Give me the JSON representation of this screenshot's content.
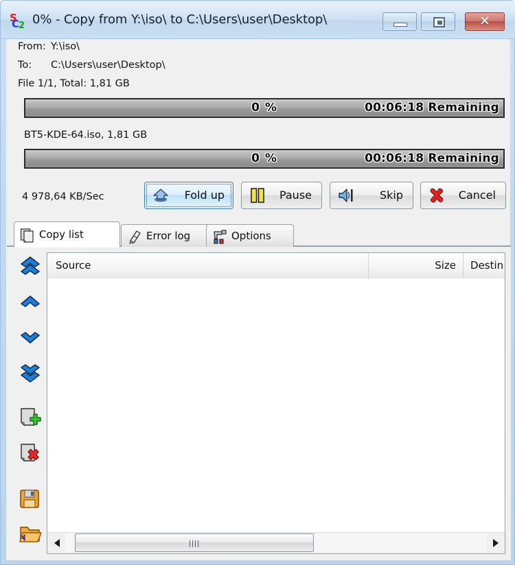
{
  "window": {
    "title": "0% - Copy from Y:\\iso\\ to C:\\Users\\user\\Desktop\\",
    "app_icon": "supercopier-sc2-icon",
    "controls": {
      "minimize_label": "Minimize",
      "maximize_label": "Maximize",
      "close_label": "Close",
      "close_glyph": "✕"
    },
    "accent_border": "#bcd4ec",
    "close_button_color": "#b94f45"
  },
  "transfer": {
    "from_label": "From:",
    "from_path": "Y:\\iso\\",
    "to_label": "To:",
    "to_path": "C:\\Users\\user\\Desktop\\",
    "file_summary": "File 1/1, Total: 1,81 GB",
    "speed": "4 978,64 KB/Sec",
    "current_file": "BT5-KDE-64.iso, 1,81 GB",
    "total_progress": {
      "percent_text": "0 %",
      "percent_value": 0,
      "remaining_text": "00:06:18 Remaining"
    },
    "file_progress": {
      "percent_text": "0 %",
      "percent_value": 0,
      "remaining_text": "00:06:18 Remaining"
    }
  },
  "buttons": [
    {
      "id": "fold",
      "label": "Fold up",
      "icon": "fold-up-arrow-icon",
      "focused": true
    },
    {
      "id": "pause",
      "label": "Pause",
      "icon": "pause-bars-icon",
      "focused": false
    },
    {
      "id": "skip",
      "label": "Skip",
      "icon": "skip-next-icon",
      "focused": false
    },
    {
      "id": "cancel",
      "label": "Cancel",
      "icon": "cancel-red-x-icon",
      "focused": false
    }
  ],
  "tabs": [
    {
      "id": "copylist",
      "label": "Copy list",
      "icon": "documents-stack-icon",
      "active": true
    },
    {
      "id": "errorlog",
      "label": "Error log",
      "icon": "error-log-note-icon",
      "active": false
    },
    {
      "id": "options",
      "label": "Options",
      "icon": "options-tools-icon",
      "active": false
    }
  ],
  "left_toolbar": [
    {
      "id": "move-top",
      "icon": "double-chevron-up-icon",
      "tooltip": "Move to top"
    },
    {
      "id": "move-up",
      "icon": "chevron-up-icon",
      "tooltip": "Move up"
    },
    {
      "id": "move-down",
      "icon": "chevron-down-icon",
      "tooltip": "Move down"
    },
    {
      "id": "move-bottom",
      "icon": "double-chevron-down-icon",
      "tooltip": "Move to bottom"
    },
    {
      "id": "add-file",
      "icon": "add-file-plus-icon",
      "tooltip": "Add file"
    },
    {
      "id": "remove-file",
      "icon": "remove-file-x-icon",
      "tooltip": "Remove file"
    },
    {
      "id": "save-list",
      "icon": "floppy-save-icon",
      "tooltip": "Save list"
    },
    {
      "id": "open-list",
      "icon": "open-folder-icon",
      "tooltip": "Open list"
    }
  ],
  "copy_list": {
    "columns": [
      {
        "id": "source",
        "label": "Source",
        "align": "left"
      },
      {
        "id": "size",
        "label": "Size",
        "align": "right"
      },
      {
        "id": "destination",
        "label": "Destin",
        "align": "left"
      }
    ],
    "rows": []
  },
  "scrollbar": {
    "left_arrow": "scroll-left-arrow-icon",
    "right_arrow": "scroll-right-arrow-icon",
    "thumb": "horizontal-scroll-thumb"
  }
}
